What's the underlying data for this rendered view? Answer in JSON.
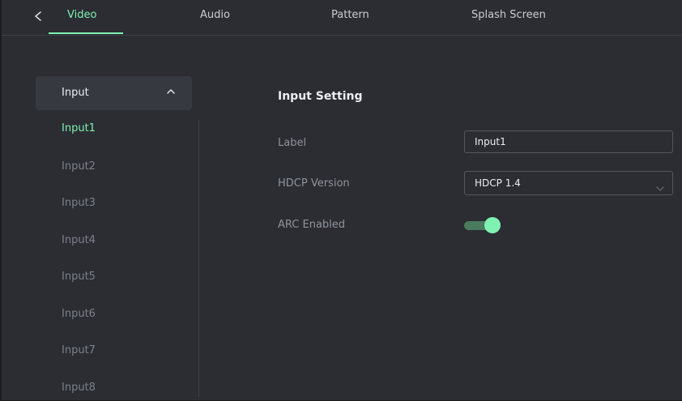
{
  "tabs": [
    {
      "label": "Video",
      "active": true
    },
    {
      "label": "Audio",
      "active": false
    },
    {
      "label": "Pattern",
      "active": false
    },
    {
      "label": "Splash Screen",
      "active": false
    }
  ],
  "menu": {
    "group_label": "Input",
    "group_expanded": true,
    "items": [
      {
        "label": "Input1",
        "active": true
      },
      {
        "label": "Input2",
        "active": false
      },
      {
        "label": "Input3",
        "active": false
      },
      {
        "label": "Input4",
        "active": false
      },
      {
        "label": "Input5",
        "active": false
      },
      {
        "label": "Input6",
        "active": false
      },
      {
        "label": "Input7",
        "active": false
      },
      {
        "label": "Input8",
        "active": false
      }
    ]
  },
  "settings": {
    "title": "Input Setting",
    "label_field": {
      "label": "Label",
      "value": "Input1"
    },
    "hdcp_field": {
      "label": "HDCP Version",
      "value": "HDCP 1.4"
    },
    "arc_field": {
      "label": "ARC Enabled",
      "enabled": true
    }
  },
  "colors": {
    "accent": "#7ff2b3",
    "background": "#2b2d33",
    "panel": "#363940",
    "toggle_track": "#4a7b5e"
  },
  "icons": {
    "back": "chevron-left-icon",
    "collapse": "chevron-up-icon",
    "dropdown": "chevron-down-icon"
  }
}
